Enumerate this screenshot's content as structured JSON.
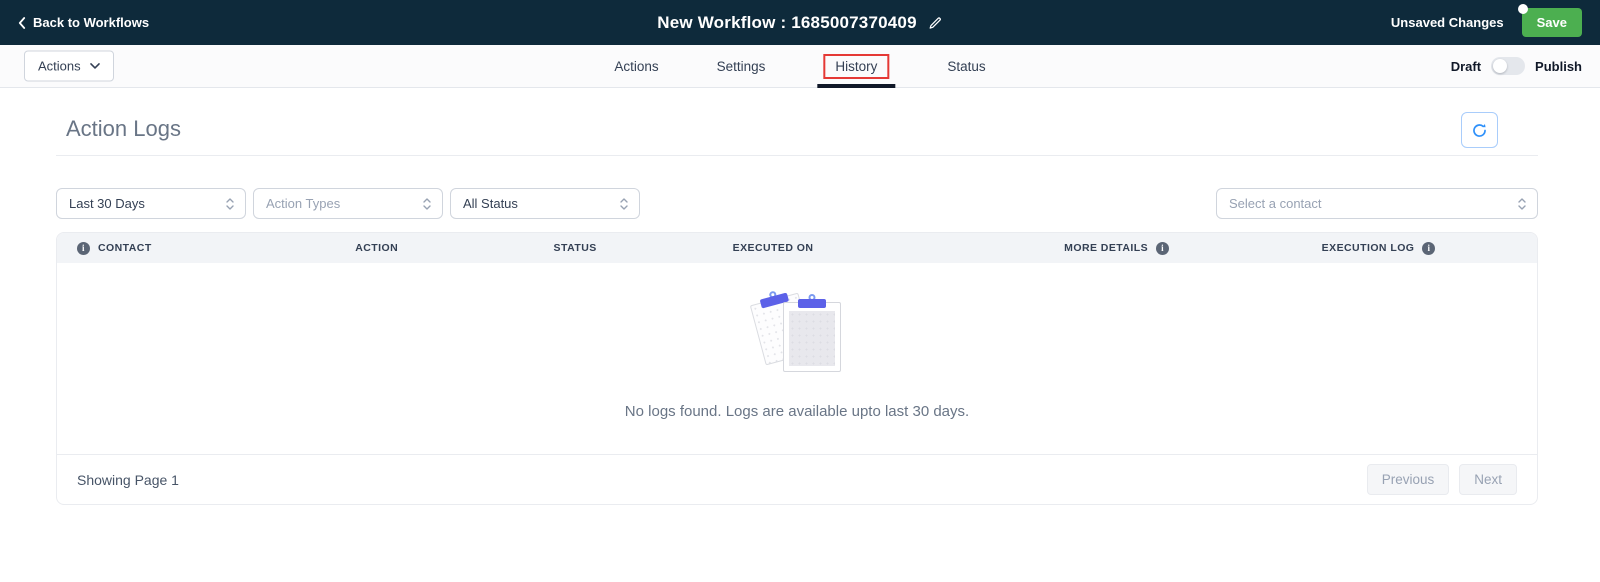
{
  "header": {
    "back_label": "Back to Workflows",
    "title": "New Workflow : 1685007370409",
    "unsaved_label": "Unsaved Changes",
    "save_label": "Save"
  },
  "toolbar": {
    "actions_dropdown_label": "Actions",
    "tabs": [
      {
        "label": "Actions",
        "active": false
      },
      {
        "label": "Settings",
        "active": false
      },
      {
        "label": "History",
        "active": true,
        "highlighted_with_red_box": true
      },
      {
        "label": "Status",
        "active": false
      }
    ],
    "draft_label": "Draft",
    "publish_label": "Publish",
    "toggle_state": "draft"
  },
  "main": {
    "title": "Action Logs",
    "filters": {
      "date_range_value": "Last 30 Days",
      "action_types_placeholder": "Action Types",
      "status_value": "All Status",
      "contact_placeholder": "Select a contact"
    },
    "table": {
      "columns": [
        "CONTACT",
        "ACTION",
        "STATUS",
        "EXECUTED ON",
        "MORE DETAILS",
        "EXECUTION LOG"
      ],
      "empty_message": "No logs found. Logs are available upto last 30 days."
    },
    "pagination": {
      "showing_label": "Showing Page 1",
      "previous_label": "Previous",
      "next_label": "Next"
    }
  },
  "colors": {
    "header_bg": "#0E2A3B",
    "save_green": "#4CAF50",
    "accent_blue": "#2E90FA",
    "clip_indigo": "#5C61E8",
    "highlight_red": "#E53935",
    "active_tab_underline": "#101828"
  }
}
